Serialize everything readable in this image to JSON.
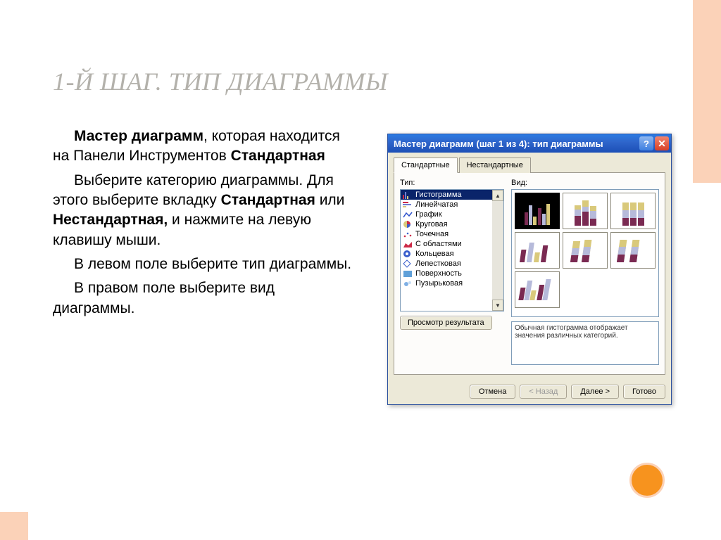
{
  "slide": {
    "title": "1-Й ШАГ. ТИП ДИАГРАММЫ",
    "p1_lead": "Мастер диаграмм",
    "p1_rest": ", которая находится на Панели Инструментов ",
    "p1_bold2": "Стандартная",
    "p2_a": "Выберите категорию диаграммы. Для этого выберите вкладку ",
    "p2_b1": "Стандартная",
    "p2_mid": " или ",
    "p2_b2": "Нестандартная,",
    "p2_c": " и нажмите на левую клавишу мыши.",
    "p3": "В левом поле выберите тип диаграммы.",
    "p4": "В правом поле выберите вид диаграммы."
  },
  "dialog": {
    "title": "Мастер диаграмм (шаг 1 из 4): тип диаграммы",
    "help": "?",
    "close": "✕",
    "tabs": {
      "standard": "Стандартные",
      "custom": "Нестандартные"
    },
    "labels": {
      "type": "Тип:",
      "view": "Вид:"
    },
    "types": [
      "Гистограмма",
      "Линейчатая",
      "График",
      "Круговая",
      "Точечная",
      "С областями",
      "Кольцевая",
      "Лепестковая",
      "Поверхность",
      "Пузырьковая"
    ],
    "description": "Обычная гистограмма отображает значения различных категорий.",
    "preview_btn": "Просмотр результата",
    "buttons": {
      "cancel": "Отмена",
      "back": "< Назад",
      "next": "Далее >",
      "finish": "Готово"
    }
  },
  "colors": {
    "accent": "#f7931e",
    "pale": "#fbd2b8",
    "titlebar": "#2a7ae2"
  }
}
